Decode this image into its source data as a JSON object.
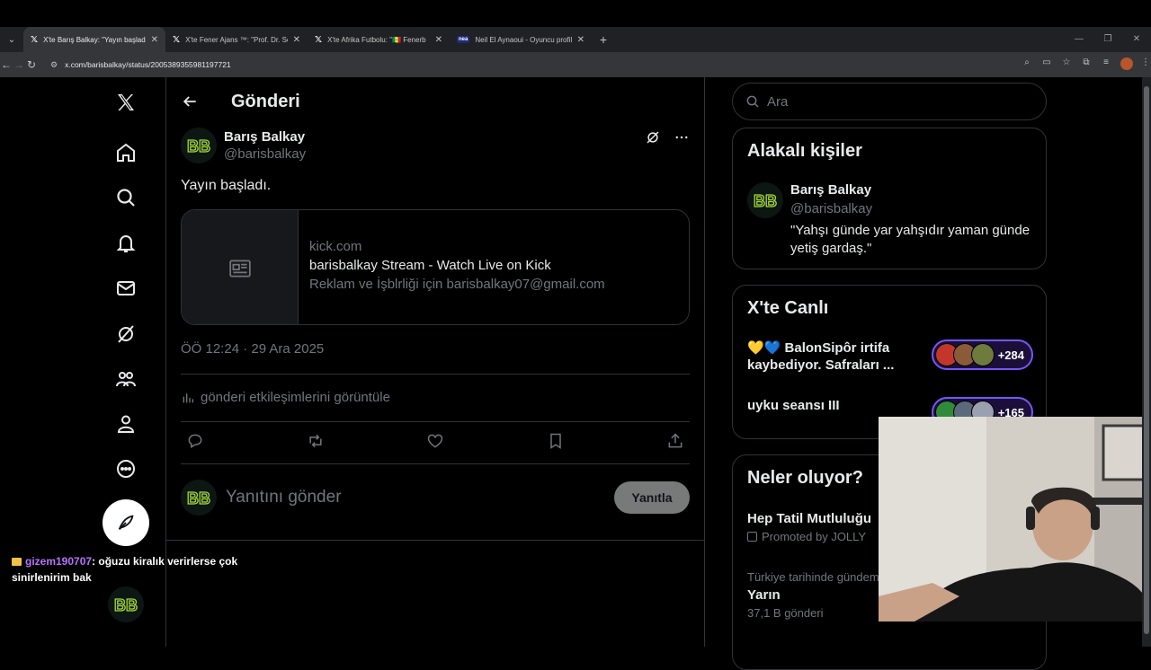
{
  "browser": {
    "tabs": [
      {
        "title": "X'te Barış Balkay: \"Yayın başladı.",
        "favicon": "x-icon",
        "active": true
      },
      {
        "title": "X'te Fener Ajans ™: \"Prof. Dr. Se",
        "favicon": "x-icon",
        "active": false
      },
      {
        "title": "X'te Afrika Futbolu: \"🇸🇳 Fenerb",
        "favicon": "x-icon",
        "active": false
      },
      {
        "title": "Neil El Aynaoui - Oyuncu profili",
        "favicon": "nea-icon",
        "active": false
      }
    ],
    "url": "x.com/barisbalkay/status/2005389355981197721"
  },
  "header": {
    "title": "Gönderi"
  },
  "post": {
    "author_name": "Barış Balkay",
    "author_handle": "@barisbalkay",
    "avatar_text": "BB",
    "text": "Yayın başladı.",
    "card": {
      "domain": "kick.com",
      "title": "barisbalkay Stream - Watch Live on Kick",
      "description": "Reklam ve İşblrliği için barisbalkay07@gmail.com"
    },
    "timestamp": "ÖÖ 12:24 · 29 Ara 2025",
    "analytics_label": "gönderi etkileşimlerini görüntüle",
    "reply_placeholder": "Yanıtını gönder",
    "reply_button": "Yanıtla"
  },
  "sidebar": {
    "search_placeholder": "Ara",
    "related": {
      "title": "Alakalı kişiler",
      "name": "Barış Balkay",
      "handle": "@barisbalkay",
      "bio": "\"Yahşı günde yar yahşıdır yaman günde yetiş gardaş.\""
    },
    "live": {
      "title": "X'te Canlı",
      "items": [
        {
          "title": "💛💙 BalonSipôr irtifa kaybediyor. Safraları ...",
          "count": "+284"
        },
        {
          "title": "uyku seansı III",
          "count": "+165"
        }
      ]
    },
    "trends": {
      "title": "Neler oluyor?",
      "items": [
        {
          "name": "Hep Tatil Mutluluğu",
          "sub": "Promoted by JOLLY"
        },
        {
          "context": "Türkiye tarihinde gündem",
          "name": "Yarın",
          "sub": "37,1 B gönderi"
        }
      ]
    }
  },
  "stream_chat": {
    "user": "gizem190707",
    "message": ": oğuzu kiralık verirlerse çok sinirlenirim bak"
  },
  "colors": {
    "accent": "#1d9bf0",
    "live_border": "#7856ff",
    "bb_green": "#a6d93a"
  }
}
